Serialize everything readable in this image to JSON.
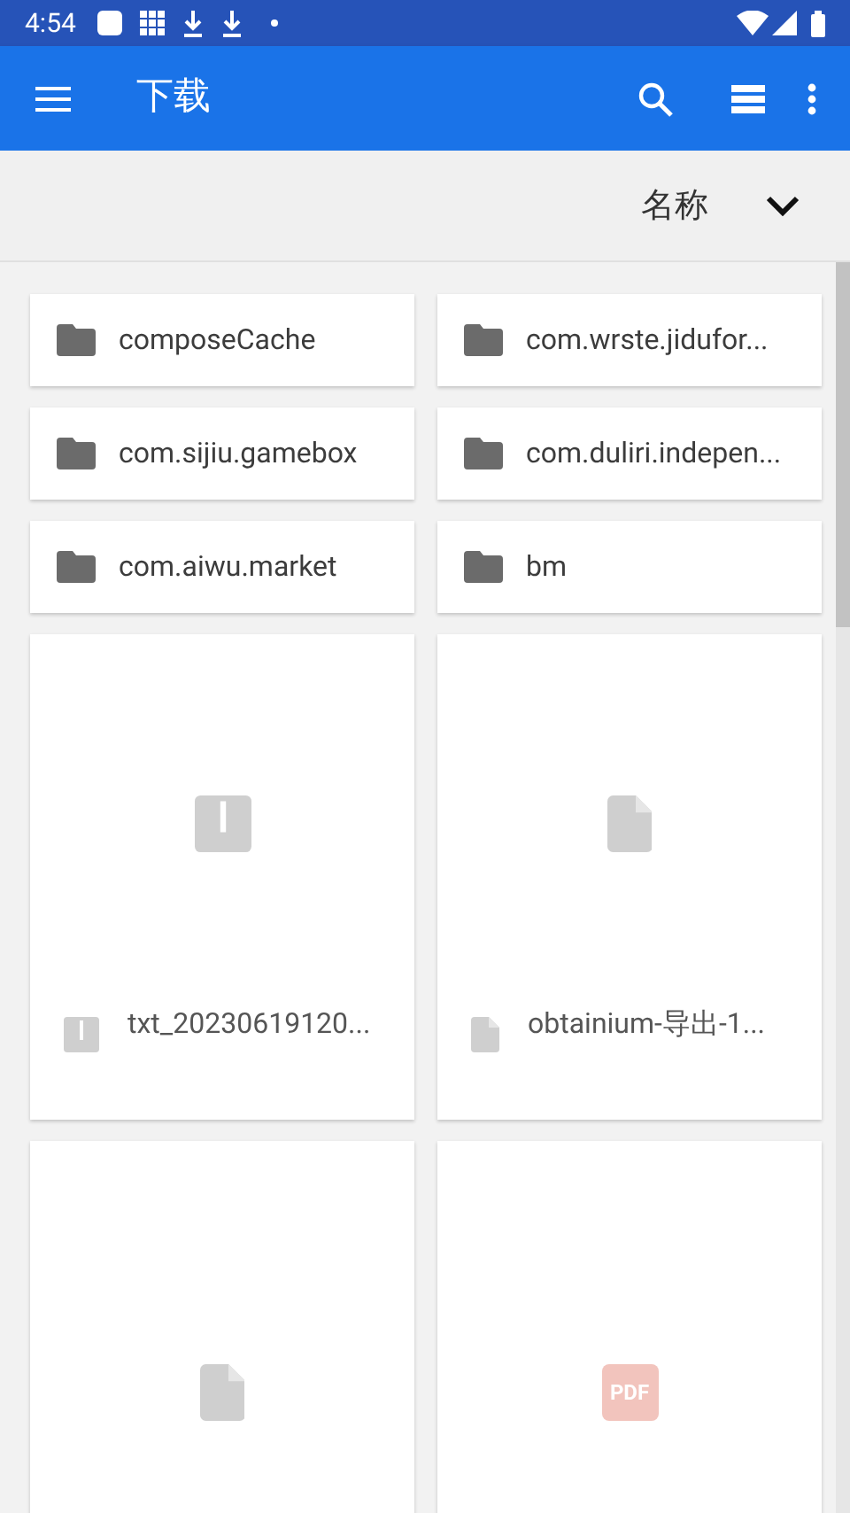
{
  "status_bar": {
    "time": "4:54"
  },
  "toolbar": {
    "title": "下载"
  },
  "sort_bar": {
    "label": "名称"
  },
  "folders": [
    {
      "name": "composeCache"
    },
    {
      "name": "com.wrste.jidufor..."
    },
    {
      "name": "com.sijiu.gamebox"
    },
    {
      "name": "com.duliri.indepen..."
    },
    {
      "name": "com.aiwu.market"
    },
    {
      "name": "bm"
    }
  ],
  "files": [
    {
      "kind": "zip",
      "name": "txt_20230619120..."
    },
    {
      "kind": "doc",
      "name": "obtainium-导出-1..."
    },
    {
      "kind": "doc"
    },
    {
      "kind": "pdf",
      "badge": "PDF"
    }
  ]
}
